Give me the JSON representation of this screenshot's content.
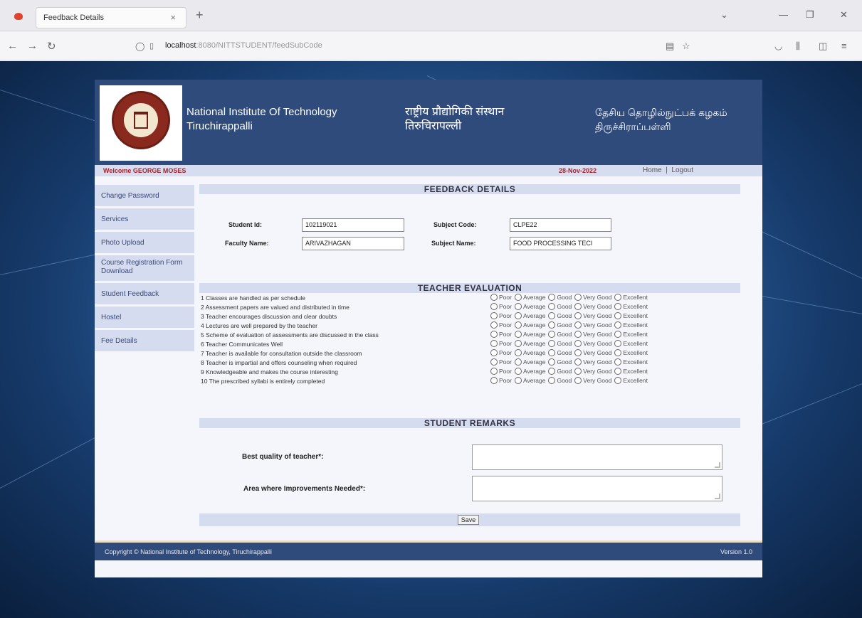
{
  "browser": {
    "tab_title": "Feedback Details",
    "tab_close": "×",
    "new_tab": "+",
    "url_host": "localhost",
    "url_rest": ":8080/NITTSTUDENT/feedSubCode",
    "min": "—",
    "restore": "❐",
    "close": "✕",
    "back": "←",
    "forward": "→",
    "reload": "↻"
  },
  "header": {
    "en_line1": "National Institute Of Technology",
    "en_line2": "Tiruchirappalli",
    "hi_line1": "राष्ट्रीय प्रौद्योगिकी संस्थान",
    "hi_line2": "तिरुचिरापल्ली",
    "ta_line1": "தேசிய தொழில்நுட்பக் கழகம்",
    "ta_line2": "திருச்சிராப்பள்ளி"
  },
  "welcome_bar": {
    "welcome": "Welcome GEORGE MOSES",
    "date": "28-Nov-2022",
    "home": "Home",
    "sep": "|",
    "logout": "Logout"
  },
  "sidebar": {
    "items": [
      {
        "label": "Change Password"
      },
      {
        "label": "Services"
      },
      {
        "label": "Photo Upload"
      },
      {
        "label": "Course Registration Form Download"
      },
      {
        "label": "Student Feedback"
      },
      {
        "label": "Hostel"
      },
      {
        "label": "Fee Details"
      }
    ]
  },
  "feedback": {
    "title": "FEEDBACK DETAILS",
    "student_id_label": "Student Id:",
    "student_id": "102119021",
    "subject_code_label": "Subject Code:",
    "subject_code": "CLPE22",
    "faculty_name_label": "Faculty Name:",
    "faculty_name": "ARIVAZHAGAN",
    "subject_name_label": "Subject Name:",
    "subject_name": "FOOD PROCESSING TECI"
  },
  "evaluation": {
    "title": "TEACHER EVALUATION",
    "options": [
      "Poor",
      "Average",
      "Good",
      "Very Good",
      "Excellent"
    ],
    "questions": [
      "1  Classes are handled as per schedule",
      "2  Assessment papers are valued and distributed in time",
      "3  Teacher encourages discussion and clear doubts",
      "4  Lectures are well prepared by the teacher",
      "5  Scheme of evaluation of assessments are discussed in the class",
      "6  Teacher Communicates Well",
      "7  Teacher is available for consultation outside the classroom",
      "8  Teacher is impartial and offers counseling when required",
      "9  Knowledgeable and makes the course interesting",
      "10 The prescribed syllabi is entirely completed"
    ]
  },
  "remarks": {
    "title": "STUDENT REMARKS",
    "best_quality_label": "Best quality of teacher*:",
    "improvement_label": "Area where Improvements Needed*:"
  },
  "save_label": "Save",
  "footer": {
    "copyright": "Copyright © National Institute of Technology, Tiruchirappalli",
    "version": "Version 1.0"
  }
}
